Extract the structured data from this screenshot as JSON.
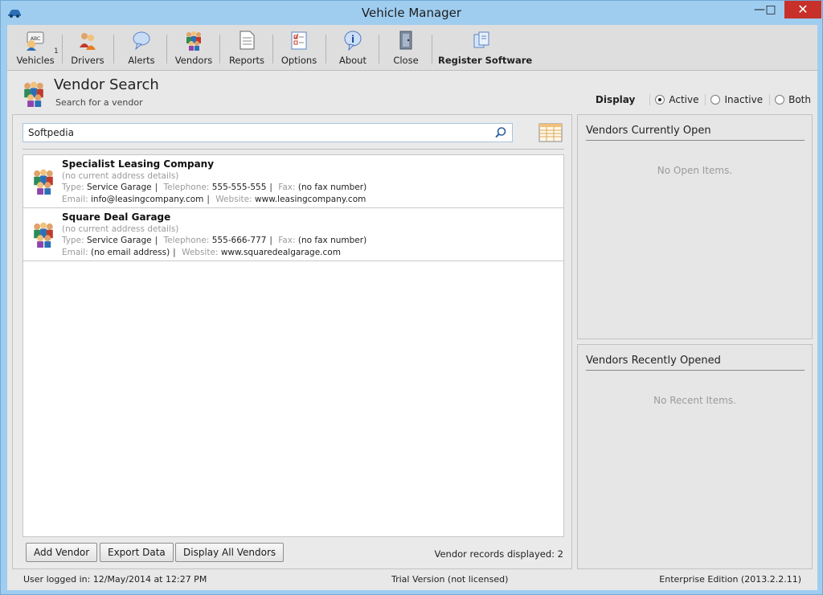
{
  "window": {
    "title": "Vehicle Manager",
    "min_glyph": "—",
    "max_glyph": "□",
    "close_glyph": "✕"
  },
  "toolbar": {
    "vehicles": "Vehicles",
    "vehicles_badge": "1",
    "drivers": "Drivers",
    "alerts": "Alerts",
    "vendors": "Vendors",
    "reports": "Reports",
    "options": "Options",
    "about": "About",
    "close": "Close",
    "register": "Register Software"
  },
  "page": {
    "title": "Vendor Search",
    "subtitle": "Search for a vendor"
  },
  "display": {
    "label": "Display",
    "options": [
      "Active",
      "Inactive",
      "Both"
    ],
    "selected": "Active"
  },
  "search": {
    "value": "Softpedia"
  },
  "vendors": [
    {
      "name": "Specialist Leasing Company",
      "address": "(no current address details)",
      "type_label": "Type:",
      "type": "Service Garage",
      "telephone_label": "Telephone:",
      "telephone": "555-555-555",
      "fax_label": "Fax:",
      "fax": "(no fax number)",
      "email_label": "Email:",
      "email": "info@leasingcompany.com",
      "website_label": "Website:",
      "website": "www.leasingcompany.com"
    },
    {
      "name": "Square Deal Garage",
      "address": "(no current address details)",
      "type_label": "Type:",
      "type": "Service Garage",
      "telephone_label": "Telephone:",
      "telephone": "555-666-777",
      "fax_label": "Fax:",
      "fax": "(no fax number)",
      "email_label": "Email:",
      "email": "(no email address)",
      "website_label": "Website:",
      "website": "www.squaredealgarage.com"
    }
  ],
  "buttons": {
    "add": "Add Vendor",
    "export": "Export Data",
    "display_all": "Display All Vendors"
  },
  "records_displayed": "Vendor records displayed:  2",
  "panels": {
    "open_title": "Vendors Currently Open",
    "open_empty": "No Open Items.",
    "recent_title": "Vendors Recently Opened",
    "recent_empty": "No Recent Items."
  },
  "status": {
    "user": "User logged in:  12/May/2014 at 12:27 PM",
    "trial": "Trial Version (not licensed)",
    "edition": "Enterprise Edition (2013.2.2.11)"
  }
}
